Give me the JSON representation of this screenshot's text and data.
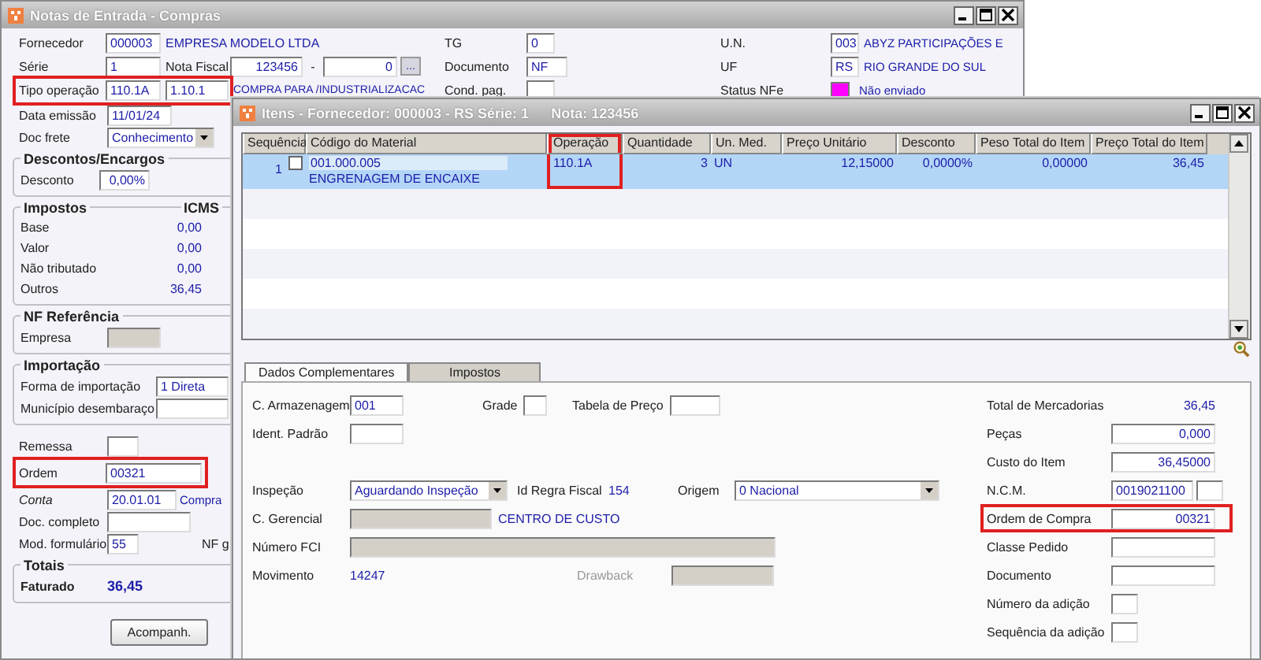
{
  "main_window": {
    "title": "Notas de Entrada - Compras",
    "fornecedor": {
      "label": "Fornecedor",
      "code": "000003",
      "name": "EMPRESA MODELO LTDA"
    },
    "serie": {
      "label": "Série",
      "value": "1"
    },
    "nota_fiscal": {
      "label": "Nota Fiscal",
      "number": "123456",
      "separator": "-",
      "sequence": "0",
      "button": "..."
    },
    "tipo_operacao": {
      "highlighted": true,
      "label": "Tipo operação",
      "code": "110.1A",
      "cfop": "1.10.1",
      "description": "COMPRA PARA /INDUSTRIALIZACAC"
    },
    "tg": {
      "label": "TG",
      "value": "0"
    },
    "documento": {
      "label": "Documento",
      "value": "NF"
    },
    "cond_pag": {
      "label": "Cond. pag."
    },
    "un": {
      "label": "U.N.",
      "code": "003",
      "name": "ABYZ PARTICIPAÇÕES E"
    },
    "uf": {
      "label": "UF",
      "code": "RS",
      "name": "RIO GRANDE DO SUL"
    },
    "status_nfe": {
      "label": "Status NFe",
      "color": "#ff00ff",
      "text": "Não enviado"
    },
    "data_emissao": {
      "label": "Data emissão",
      "value": "11/01/24"
    },
    "doc_frete": {
      "label": "Doc frete",
      "value": "Conhecimento"
    },
    "descontos": {
      "title": "Descontos/Encargos",
      "label": "Desconto",
      "value": "0,00%"
    },
    "impostos": {
      "title": "Impostos",
      "column": "ICMS",
      "rows": [
        {
          "label": "Base",
          "value": "0,00"
        },
        {
          "label": "Valor",
          "value": "0,00"
        },
        {
          "label": "Não tributado",
          "value": "0,00"
        },
        {
          "label": "Outros",
          "value": "36,45"
        }
      ]
    },
    "nf_referencia": {
      "title": "NF Referência",
      "label": "Empresa"
    },
    "importacao": {
      "title": "Importação",
      "forma_label": "Forma de importação",
      "forma_value": "1 Direta",
      "municipio_label": "Município desembaraço"
    },
    "remessa": {
      "label": "Remessa"
    },
    "ordem": {
      "highlighted": true,
      "label": "Ordem",
      "value": "00321"
    },
    "conta": {
      "label": "Conta",
      "code": "20.01.01",
      "name": "Compra"
    },
    "doc_completo": {
      "label": "Doc. completo"
    },
    "mod_formulario": {
      "label": "Mod. formulário",
      "value": "55",
      "note": "NF g"
    },
    "totais": {
      "title": "Totais",
      "label": "Faturado",
      "value": "36,45"
    },
    "buttons": [
      "Acompanh."
    ]
  },
  "items_window": {
    "title": "Itens - Fornecedor: 000003 - RS Série: 1",
    "nota": "Nota: 123456",
    "columns": [
      {
        "label": "Sequência",
        "highlighted": false
      },
      {
        "label": "Código do Material",
        "highlighted": false
      },
      {
        "label": "Operação",
        "highlighted": true
      },
      {
        "label": "Quantidade",
        "highlighted": false
      },
      {
        "label": "Un. Med.",
        "highlighted": false
      },
      {
        "label": "Preço Unitário",
        "highlighted": false
      },
      {
        "label": "Desconto",
        "highlighted": false
      },
      {
        "label": "Peso Total do Item",
        "highlighted": false
      },
      {
        "label": "Preço Total do Item",
        "highlighted": false
      }
    ],
    "rows": [
      {
        "selected": true,
        "checked": false,
        "sequencia": "1",
        "codigo": "001.000.005",
        "descricao": "ENGRENAGEM DE ENCAIXE",
        "operacao": "110.1A",
        "quantidade": "3",
        "unidade": "UN",
        "preco_unitario": "12,15000",
        "desconto": "0,0000%",
        "peso_total": "0,00000",
        "preco_total": "36,45"
      }
    ],
    "tabs": [
      {
        "label": "Dados Complementares",
        "selected": true
      },
      {
        "label": "Impostos",
        "selected": false
      }
    ],
    "form": {
      "armazenagem": {
        "label": "C. Armazenagem",
        "value": "001"
      },
      "grade": {
        "label": "Grade"
      },
      "tabela_preco": {
        "label": "Tabela de Preço"
      },
      "ident_padrao": {
        "label": "Ident. Padrão"
      },
      "inspecao": {
        "label": "Inspeção",
        "value": "Aguardando Inspeção"
      },
      "id_regra_fiscal": {
        "label": "Id Regra Fiscal",
        "value": "154"
      },
      "origem": {
        "label": "Origem",
        "value": "0 Nacional"
      },
      "c_gerencial": {
        "label": "C. Gerencial",
        "name": "CENTRO DE CUSTO"
      },
      "numero_fci": {
        "label": "Número FCI"
      },
      "movimento": {
        "label": "Movimento",
        "value": "14247"
      },
      "drawback": {
        "label": "Drawback",
        "disabled": true
      }
    },
    "totals": [
      {
        "kind": "text",
        "label": "Total de Mercadorias",
        "value": "36,45",
        "highlighted": false
      },
      {
        "kind": "field",
        "label": "Peças",
        "value": "0,000",
        "highlighted": false
      },
      {
        "kind": "field",
        "label": "Custo do Item",
        "value": "36,45000",
        "highlighted": false
      },
      {
        "kind": "ncm",
        "label": "N.C.M.",
        "value": "0019021100",
        "highlighted": false
      },
      {
        "kind": "field",
        "label": "Ordem de Compra",
        "value": "00321",
        "highlighted": true
      },
      {
        "kind": "field",
        "label": "Classe Pedido",
        "highlighted": false
      },
      {
        "kind": "field",
        "label": "Documento",
        "highlighted": false
      },
      {
        "kind": "small",
        "label": "Número da adição",
        "highlighted": false
      },
      {
        "kind": "small",
        "label": "Sequência da adição",
        "highlighted": false
      }
    ]
  }
}
